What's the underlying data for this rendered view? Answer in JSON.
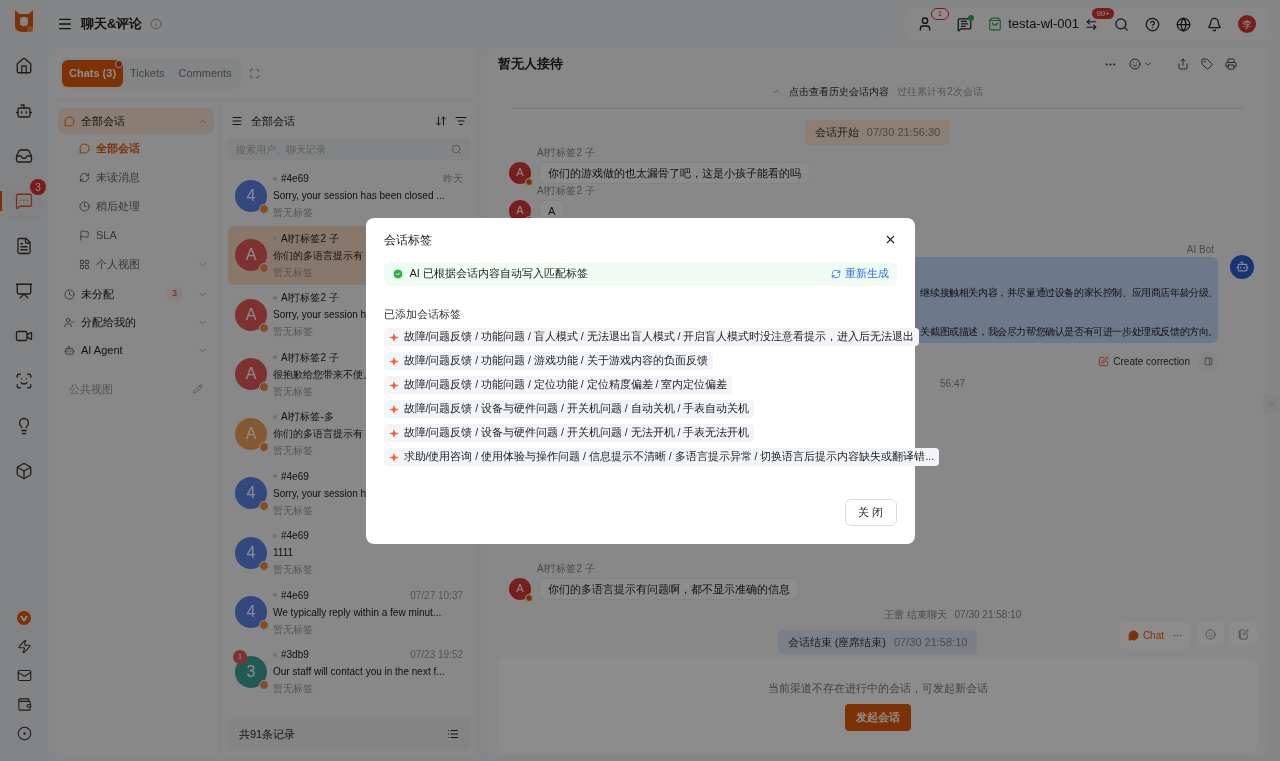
{
  "top_bar": {
    "title": "聊天&评论",
    "agent_badge": "1",
    "account": "testa-wl-001",
    "switch_badge": "99+",
    "user_avatar": "李"
  },
  "rail": {
    "items": [
      {
        "kind": "home",
        "selected": false
      },
      {
        "kind": "robot",
        "selected": false
      },
      {
        "kind": "inbox",
        "selected": false
      },
      {
        "kind": "chat",
        "selected": true,
        "badge": "3"
      },
      {
        "kind": "doc",
        "selected": false
      },
      {
        "kind": "monitor",
        "selected": false
      },
      {
        "kind": "video",
        "selected": false
      },
      {
        "kind": "scan",
        "selected": false
      },
      {
        "kind": "bulb",
        "selected": false
      },
      {
        "kind": "cube",
        "selected": false
      }
    ],
    "bottom": [
      {
        "kind": "vip"
      },
      {
        "kind": "bolt"
      },
      {
        "kind": "mail"
      },
      {
        "kind": "wallet"
      },
      {
        "kind": "settings"
      }
    ]
  },
  "tabs": [
    {
      "label": "Chats (3)",
      "selected": true,
      "notify": true
    },
    {
      "label": "Tickets",
      "selected": false,
      "notify": false
    },
    {
      "label": "Comments",
      "selected": false,
      "notify": false
    }
  ],
  "nav": {
    "groups": [
      {
        "label": "全部会话",
        "kind": "chat",
        "expanded": true,
        "selected": true,
        "children": [
          {
            "label": "全部会话",
            "kind": "chat",
            "selected": true
          },
          {
            "label": "未读消息",
            "kind": "unread",
            "selected": false
          },
          {
            "label": "稍后处理",
            "kind": "later",
            "selected": false
          },
          {
            "label": "SLA",
            "kind": "flag",
            "selected": false
          },
          {
            "label": "个人视图",
            "kind": "views",
            "selected": false,
            "expanded": false
          }
        ]
      },
      {
        "label": "未分配",
        "kind": "clock",
        "count": "3",
        "expanded": false,
        "selected": false
      },
      {
        "label": "分配给我的",
        "kind": "mine",
        "expanded": false,
        "selected": false
      },
      {
        "label": "AI Agent",
        "kind": "agent",
        "expanded": false,
        "selected": false
      }
    ],
    "public_views": "公共视图"
  },
  "list": {
    "title": "全部会话",
    "search_placeholder": "搜索用户、聊天记录",
    "total": "共91条记录",
    "items": [
      {
        "name": "#4e69",
        "time": "昨天",
        "preview": "Sorry, your session has been closed ...",
        "tag": "暂无标签",
        "avatar": "4",
        "kind": "visitor",
        "selected": false
      },
      {
        "name": "AI打标签2 子",
        "preview": "你们的多语言提示有",
        "tag": "暂无标签",
        "avatar": "A",
        "kind": "tagged",
        "selected": true
      },
      {
        "name": "AI打标签2 子",
        "preview": "Sorry, your session h",
        "tag": "暂无标签",
        "avatar": "A",
        "kind": "tagged",
        "selected": false
      },
      {
        "name": "AI打标签2 子",
        "preview": "很抱歉给您带来不便。",
        "tag": "暂无标签",
        "avatar": "A",
        "kind": "tagged",
        "selected": false
      },
      {
        "name": "AI打标签-多",
        "preview": "你们的多语言提示有",
        "tag": "暂无标签",
        "avatar": "A",
        "kind": "multi",
        "selected": false
      },
      {
        "name": "#4e69",
        "preview": "Sorry, your session h",
        "tag": "暂无标签",
        "avatar": "4",
        "kind": "visitor",
        "selected": false
      },
      {
        "name": "#4e69",
        "preview": "1111",
        "tag": "暂无标签",
        "avatar": "4",
        "kind": "visitor",
        "selected": false
      },
      {
        "name": "#4e69",
        "time": "07/27 10:37",
        "preview": "We typically reply within a few minut...",
        "tag": "暂无标签",
        "avatar": "4",
        "kind": "visitor",
        "selected": false
      },
      {
        "name": "#3db9",
        "time": "07/23 19:52",
        "preview": "Our staff will contact you in the next f...",
        "tag": "暂无标签",
        "avatar": "3",
        "kind": "staff",
        "selected": false,
        "unread": "1"
      }
    ]
  },
  "chat": {
    "title": "暂无人接待",
    "history_link": "点击查看历史会话内容",
    "history_note": "过往累计有2次会话",
    "events": [
      {
        "kind": "start",
        "label": "会话开始",
        "time": "07/30 21:56:30"
      },
      {
        "kind": "customer",
        "sender": "AI打标签2 子",
        "avatar": "A",
        "text": "你们的游戏做的也太漏骨了吧，这是小孩子能看的吗"
      },
      {
        "kind": "customer",
        "sender": "AI打标签2 子",
        "avatar": "A",
        "text": "A"
      },
      {
        "kind": "bot",
        "sender": "AI Bot",
        "lines": [
          "继续接触相关内容，并尽量通过设备的家长控制、应用商店年龄分级、",
          "关截图或描述，我会尽力帮您确认是否有可进一步处理或反馈的方向。"
        ],
        "action": "Create correction"
      },
      {
        "kind": "note",
        "text": "56:47"
      }
    ],
    "events_end": [
      {
        "kind": "customer",
        "sender": "AI打标签2 子",
        "avatar": "A",
        "text": "你们的多语言提示有问题啊，都不显示准确的信息"
      },
      {
        "kind": "note",
        "text": "王蕾 结束聊天",
        "time": "07/30 21:58:10"
      },
      {
        "kind": "end",
        "label": "会话结束 (座席结束)",
        "time": "07/30 21:58:10"
      }
    ],
    "float_chat": "Chat",
    "empty_note": "当前渠道不存在进行中的会话，可发起新会话",
    "start_button": "发起会话"
  },
  "modal": {
    "title": "会话标签",
    "banner": "AI 已根据会话内容自动写入匹配标签",
    "regenerate": "重新生成",
    "section": "已添加会话标签",
    "close": "关 闭",
    "tags": [
      "故障/问题反馈 / 功能问题 / 盲人模式 / 无法退出盲人模式 / 开启盲人模式时没注意看提示，进入后无法退出",
      "故障/问题反馈 / 功能问题 / 游戏功能 / 关于游戏内容的负面反馈",
      "故障/问题反馈 / 功能问题 / 定位功能 / 定位精度偏差 / 室内定位偏差",
      "故障/问题反馈 / 设备与硬件问题 / 开关机问题 / 自动关机 / 手表自动关机",
      "故障/问题反馈 / 设备与硬件问题 / 开关机问题 / 无法开机 / 手表无法开机",
      "求助/使用咨询 / 使用体验与操作问题 / 信息提示不清晰 / 多语言提示异常 / 切换语言后提示内容缺失或翻译错..."
    ]
  }
}
